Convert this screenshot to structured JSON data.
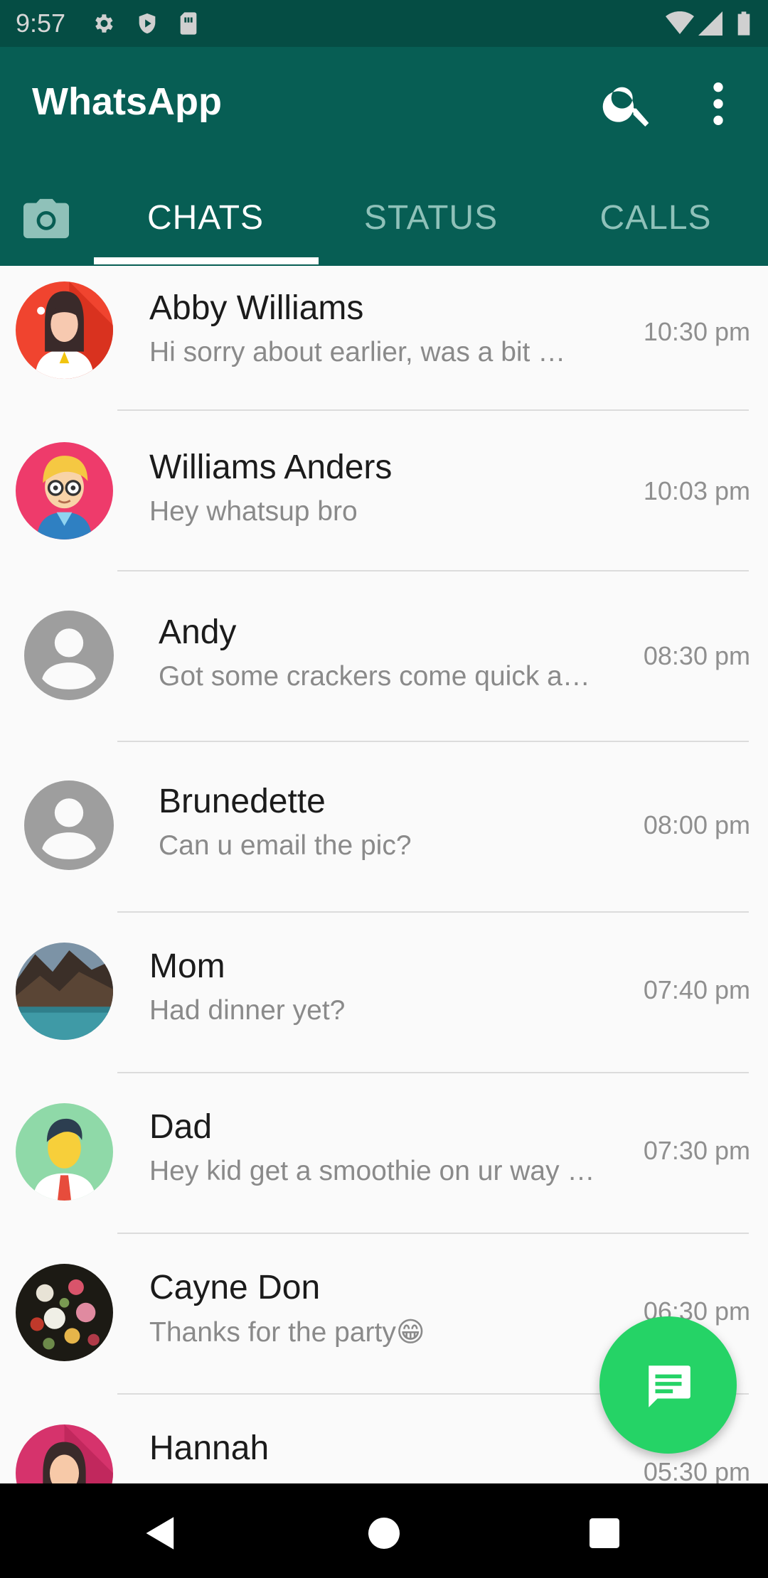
{
  "status_bar": {
    "time": "9:57",
    "icons": [
      "settings-icon",
      "shield-icon",
      "sim-card-icon",
      "wifi-icon",
      "signal-icon",
      "battery-icon"
    ]
  },
  "app_bar": {
    "title": "WhatsApp",
    "actions": [
      "search-icon",
      "more-vert-icon"
    ],
    "background": "#075e54"
  },
  "tabs": [
    {
      "id": "camera",
      "icon": "camera-icon"
    },
    {
      "id": "chats",
      "label": "CHATS",
      "selected": true
    },
    {
      "id": "status",
      "label": "STATUS"
    },
    {
      "id": "calls",
      "label": "CALLS"
    }
  ],
  "chats": [
    {
      "name": "Abby Williams",
      "message": "Hi sorry about earlier, was a bit …",
      "time": "10:30 pm",
      "avatar": "woman-avatar"
    },
    {
      "name": "Williams Anders",
      "message": "Hey whatsup bro",
      "time": "10:03 pm",
      "avatar": "boy-glasses-avatar"
    },
    {
      "name": "Andy",
      "message": "Got some crackers come quick a…",
      "time": "08:30 pm",
      "avatar": "default-person-avatar"
    },
    {
      "name": "Brunedette",
      "message": "Can u email the pic?",
      "time": "08:00 pm",
      "avatar": "default-person-avatar"
    },
    {
      "name": "Mom",
      "message": "Had dinner yet?",
      "time": "07:40 pm",
      "avatar": "lake-photo-avatar"
    },
    {
      "name": "Dad",
      "message": "Hey kid get a smoothie on ur way …",
      "time": "07:30 pm",
      "avatar": "man-avatar"
    },
    {
      "name": "Cayne Don",
      "message": "Thanks for the party😁",
      "time": "06:30 pm",
      "avatar": "flowers-photo-avatar"
    },
    {
      "name": "Hannah",
      "message": "",
      "time": "05:30 pm",
      "avatar": "girl-avatar"
    }
  ],
  "fab": {
    "icon": "new-chat-icon",
    "color": "#25d366"
  },
  "nav_bar": {
    "buttons": [
      "back-icon",
      "home-icon",
      "recents-icon"
    ]
  }
}
